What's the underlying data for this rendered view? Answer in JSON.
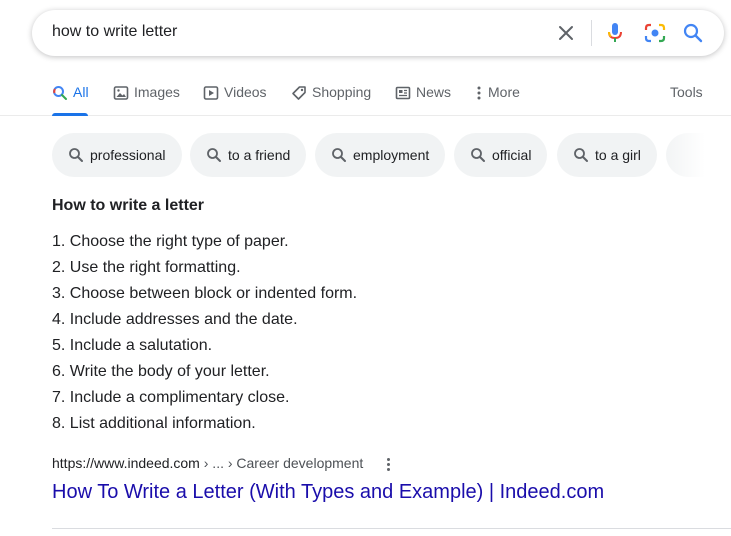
{
  "search": {
    "query": "how to write letter"
  },
  "tabs": {
    "items": [
      {
        "label": "All",
        "icon": "search-icon"
      },
      {
        "label": "Images",
        "icon": "image-icon"
      },
      {
        "label": "Videos",
        "icon": "play-icon"
      },
      {
        "label": "Shopping",
        "icon": "tag-icon"
      },
      {
        "label": "News",
        "icon": "newspaper-icon"
      },
      {
        "label": "More",
        "icon": "vertical-dots-icon"
      }
    ],
    "active": "All",
    "tools_label": "Tools"
  },
  "chips": [
    "professional",
    "to a friend",
    "employment",
    "official",
    "to a girl"
  ],
  "answer": {
    "title": "How to write a letter",
    "steps": [
      "1. Choose the right type of paper.",
      "2. Use the right formatting.",
      "3. Choose between block or indented form.",
      "4. Include addresses and the date.",
      "5. Include a salutation.",
      "6. Write the body of your letter.",
      "7. Include a complimentary close.",
      "8. List additional information."
    ]
  },
  "result": {
    "url": "https://www.indeed.com",
    "path": " › ... › Career development",
    "title": "How To Write a Letter (With Types and Example) | Indeed.com"
  },
  "colors": {
    "accent": "#1a73e8",
    "link": "#1a0dab",
    "chip_bg": "#f1f3f4",
    "text": "#202124",
    "muted": "#5f6368"
  }
}
